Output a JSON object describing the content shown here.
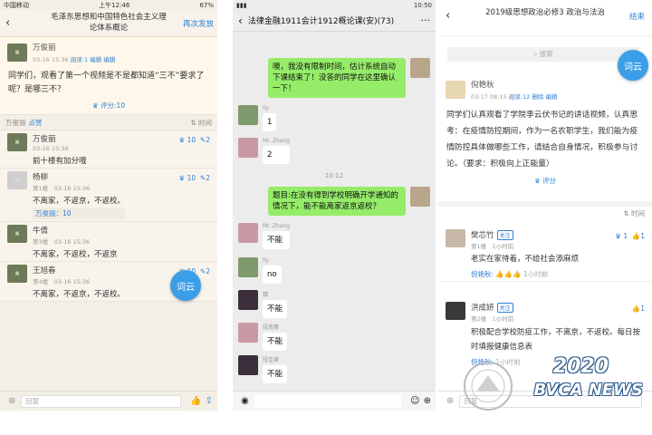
{
  "panel1": {
    "status": {
      "carrier": "中国移动",
      "time": "上午12:46",
      "battery": "67%"
    },
    "title": "毛泽东思想和中国特色社会主义理论体系概论",
    "action": "再次发放",
    "post": {
      "author": "万俊丽",
      "meta": "03-16 15:36",
      "read": "阅读:1",
      "edit1": "编辑",
      "edit2": "编辑",
      "body": "同学们，观看了第一个视频是不是都知道“三不”要求了呢？是哪三不？",
      "score": "评分:10"
    },
    "sortbar": {
      "left": "万俊丽",
      "like": "点赞",
      "right": "时间"
    },
    "replies": [
      {
        "name": "万俊丽",
        "meta": "03-16 15:36",
        "text": "前十楼有加分哦",
        "likes": "10",
        "comments": "2",
        "sub": ""
      },
      {
        "name": "杨柳",
        "meta": "第1楼　03-16 15:36",
        "text": "不离家，不返京，不返校。",
        "likes": "10",
        "comments": "2",
        "sub": "万俊丽：10"
      },
      {
        "name": "牛倩",
        "meta": "第3楼　03-16 15:36",
        "text": "不离家，不返校，不返京",
        "likes": "",
        "comments": "",
        "sub": ""
      },
      {
        "name": "王旭春",
        "meta": "第4楼　03-16 15:36",
        "text": "不离家，不返京，不返校。",
        "likes": "10",
        "comments": "2",
        "sub": ""
      }
    ],
    "fab": "词云",
    "reply_placeholder": "回复"
  },
  "panel2": {
    "status": {
      "time": "10:50"
    },
    "title": "法律金融1911会计1912概论课(安)(73)",
    "messages": [
      {
        "side": "right",
        "sender": "",
        "text": "噢，我没有限制时间，估计系统自动下课结束了！没答的同学在这里确认一下！"
      },
      {
        "side": "left",
        "sender": "lly",
        "text": "1"
      },
      {
        "side": "left",
        "sender": "Mr. Zhang",
        "text": "2"
      },
      {
        "side": "right",
        "sender": "",
        "text": "题目:在没有得到学校明确开学通知的情况下，能不能离家返京返校？"
      },
      {
        "side": "left",
        "sender": "Mr. Zhang",
        "text": "不能"
      },
      {
        "side": "left",
        "sender": "lly",
        "text": "no"
      },
      {
        "side": "left",
        "sender": "魏",
        "text": "不能"
      },
      {
        "side": "left",
        "sender": "段宽舞",
        "text": "不能"
      },
      {
        "side": "left",
        "sender": "段佳黄",
        "text": "不能"
      }
    ],
    "time_divider": "10:12"
  },
  "panel3": {
    "title": "2019级思想政治必修3 政治与法治",
    "action": "结束",
    "search": "搜索",
    "fab": "词云",
    "post": {
      "author": "倪艳秋",
      "meta": "03-17 08:15",
      "read": "阅读:12",
      "del": "删除",
      "edit": "编辑",
      "body": "同学们认真观看了学院李云伏书记的讲话视频，认真思考：在疫情防控期间，作为一名农职学生，我们能为疫情防控具体做哪些工作，请结合自身情况，积极参与讨论。（要求：积极向上正能量）",
      "score": "评分"
    },
    "sort_right": "时间",
    "replies": [
      {
        "name": "樊芯竹",
        "tag": "关注",
        "meta": "第1楼　1小时前",
        "text": "老实在家待着，不给社会添麻烦",
        "likes": "1",
        "comments": "1",
        "sub_name": "倪艳秋:",
        "sub_time": "1小时前"
      },
      {
        "name": "洪成妍",
        "tag": "关注",
        "meta": "第2楼　1小时前",
        "text": "积极配合学校防疫工作，不离京，不返校。每日按时填报健康信息表",
        "likes": "",
        "comments": "1",
        "sub_name": "倪艳秋:",
        "sub_time": "1小时前"
      }
    ],
    "reply_placeholder": "回复",
    "watermark_year": "2020",
    "watermark_name": "BVCA NEWS"
  }
}
